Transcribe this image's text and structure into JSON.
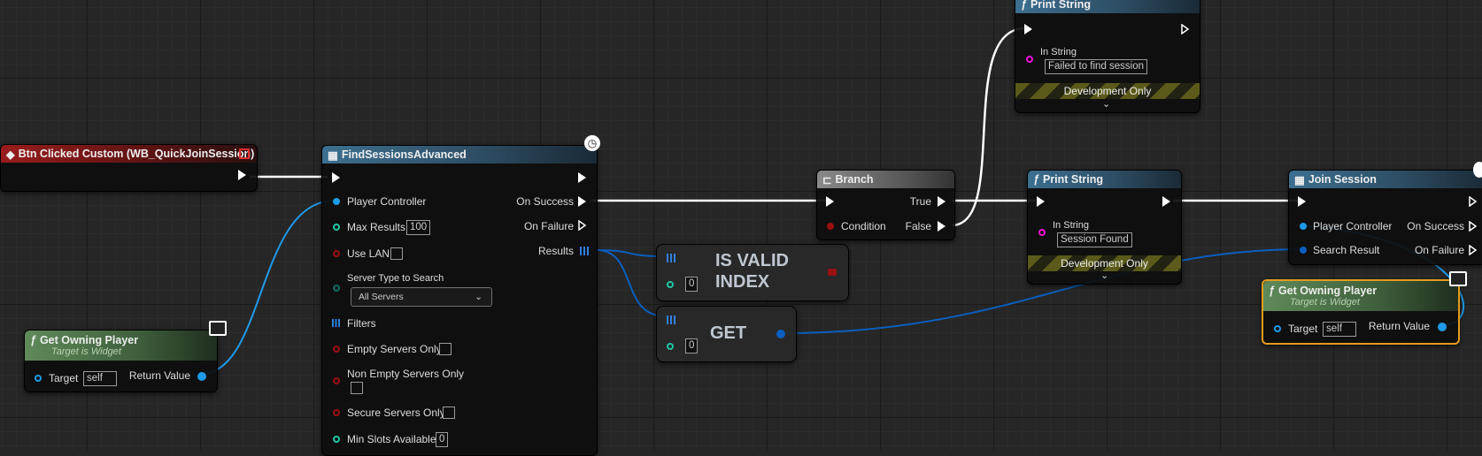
{
  "nodes": {
    "btn_clicked": {
      "title": "Btn Clicked Custom (WB_QuickJoinSession)"
    },
    "find_sessions": {
      "title": "FindSessionsAdvanced",
      "player_controller": "Player Controller",
      "max_results_label": "Max Results",
      "max_results_value": "100",
      "use_lan": "Use LAN",
      "server_type_label": "Server Type to Search",
      "server_type_value": "All Servers",
      "filters": "Filters",
      "empty_servers_only": "Empty Servers Only",
      "non_empty_servers_only": "Non Empty Servers Only",
      "secure_servers_only": "Secure Servers Only",
      "min_slots_label": "Min Slots Available",
      "min_slots_value": "0",
      "on_success": "On Success",
      "on_failure": "On Failure",
      "results": "Results"
    },
    "get_owning_player_left": {
      "title": "Get Owning Player",
      "subtitle": "Target is Widget",
      "target": "Target",
      "target_value": "self",
      "return_value": "Return Value"
    },
    "is_valid_index": {
      "line1": "IS VALID",
      "line2": "INDEX",
      "index_value": "0"
    },
    "get": {
      "label": "GET",
      "index_value": "0"
    },
    "branch": {
      "title": "Branch",
      "condition": "Condition",
      "true_label": "True",
      "false_label": "False"
    },
    "print_string_top": {
      "title": "Print String",
      "in_string": "In String",
      "value": "Failed to find session",
      "dev_only": "Development Only"
    },
    "print_string_mid": {
      "title": "Print String",
      "in_string": "In String",
      "value": "Session Found",
      "dev_only": "Development Only"
    },
    "join_session": {
      "title": "Join Session",
      "player_controller": "Player Controller",
      "search_result": "Search Result",
      "on_success": "On Success",
      "on_failure": "On Failure"
    },
    "get_owning_player_right": {
      "title": "Get Owning Player",
      "subtitle": "Target is Widget",
      "target": "Target",
      "target_value": "self",
      "return_value": "Return Value"
    }
  },
  "icons": {
    "function": "function-icon",
    "event": "event-icon",
    "latent": "clock-icon",
    "widget": "monitor-icon",
    "branch": "branch-icon",
    "macro": "grid-icon"
  },
  "colors": {
    "exec": "#ffffff",
    "object": "#1e9be8",
    "bool": "#9b1010",
    "int": "#1fc7a5",
    "string": "#f012d9",
    "struct": "#0a5fbf",
    "array": "#2f7fe0",
    "enum": "#0d6e60"
  }
}
